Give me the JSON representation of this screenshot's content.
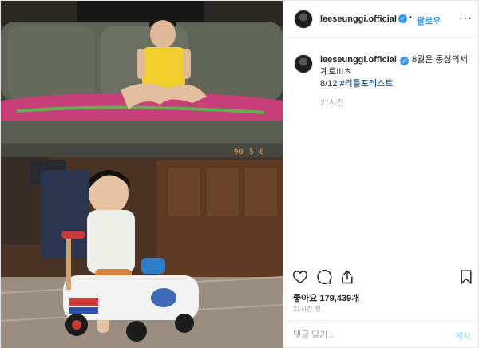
{
  "post": {
    "username": "leeseunggi.official",
    "verified_icon": "verified-badge-icon",
    "separator": "•",
    "follow_label": "팔로우",
    "more_icon": "more-options-icon",
    "more_glyph": "···"
  },
  "photo": {
    "date_stamp": "90 5 8"
  },
  "caption": {
    "username": "leeseunggi.official",
    "text": "8월은 동심의세계로!!!ㅎ",
    "line2_prefix": "8/12",
    "hashtag": "#리틀포레스트",
    "time": "21시간"
  },
  "actions": {
    "like_icon": "heart-icon",
    "comment_icon": "comment-icon",
    "share_icon": "share-icon",
    "save_icon": "bookmark-icon"
  },
  "likes": {
    "label": "좋아요 179,439개"
  },
  "posted": {
    "label": "21시간 전"
  },
  "comment": {
    "placeholder": "댓글 달기...",
    "post_label": "게시"
  },
  "colors": {
    "accent": "#3897f0",
    "text": "#262626",
    "muted": "#999999",
    "border": "#efefef",
    "post_button_disabled": "#b2dffc"
  }
}
